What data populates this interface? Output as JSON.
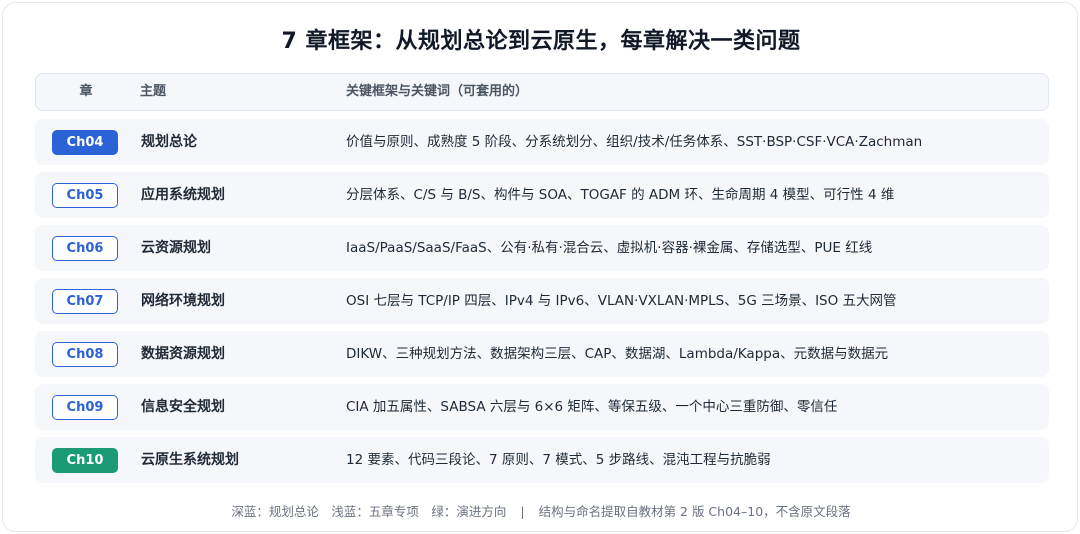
{
  "title": "7 章框架：从规划总论到云原生，每章解决一类问题",
  "header": {
    "chapter": "章",
    "topic": "主题",
    "keywords": "关键框架与关键词（可套用的）"
  },
  "rows": [
    {
      "chapter": "Ch04",
      "style": "dark",
      "topic": "规划总论",
      "keywords": "价值与原则、成熟度 5 阶段、分系统划分、组织/技术/任务体系、SST·BSP·CSF·VCA·Zachman"
    },
    {
      "chapter": "Ch05",
      "style": "light",
      "topic": "应用系统规划",
      "keywords": "分层体系、C/S 与 B/S、构件与 SOA、TOGAF 的 ADM 环、生命周期 4 模型、可行性 4 维"
    },
    {
      "chapter": "Ch06",
      "style": "light",
      "topic": "云资源规划",
      "keywords": "IaaS/PaaS/SaaS/FaaS、公有·私有·混合云、虚拟机·容器·裸金属、存储选型、PUE 红线"
    },
    {
      "chapter": "Ch07",
      "style": "light",
      "topic": "网络环境规划",
      "keywords": "OSI 七层与 TCP/IP 四层、IPv4 与 IPv6、VLAN·VXLAN·MPLS、5G 三场景、ISO 五大网管"
    },
    {
      "chapter": "Ch08",
      "style": "light",
      "topic": "数据资源规划",
      "keywords": "DIKW、三种规划方法、数据架构三层、CAP、数据湖、Lambda/Kappa、元数据与数据元"
    },
    {
      "chapter": "Ch09",
      "style": "light",
      "topic": "信息安全规划",
      "keywords": "CIA 加五属性、SABSA 六层与 6×6 矩阵、等保五级、一个中心三重防御、零信任"
    },
    {
      "chapter": "Ch10",
      "style": "green",
      "topic": "云原生系统规划",
      "keywords": "12 要素、代码三段论、7 原则、7 模式、5 步路线、混沌工程与抗脆弱"
    }
  ],
  "footer": {
    "legend": "深蓝：规划总论　浅蓝：五章专项　绿：演进方向",
    "separator": "|",
    "note": "结构与命名提取自教材第 2 版 Ch04–10，不含原文段落"
  },
  "colors": {
    "dark_blue": "#2c62d8",
    "light_blue_border": "#2c62d8",
    "green": "#1a9b76"
  }
}
